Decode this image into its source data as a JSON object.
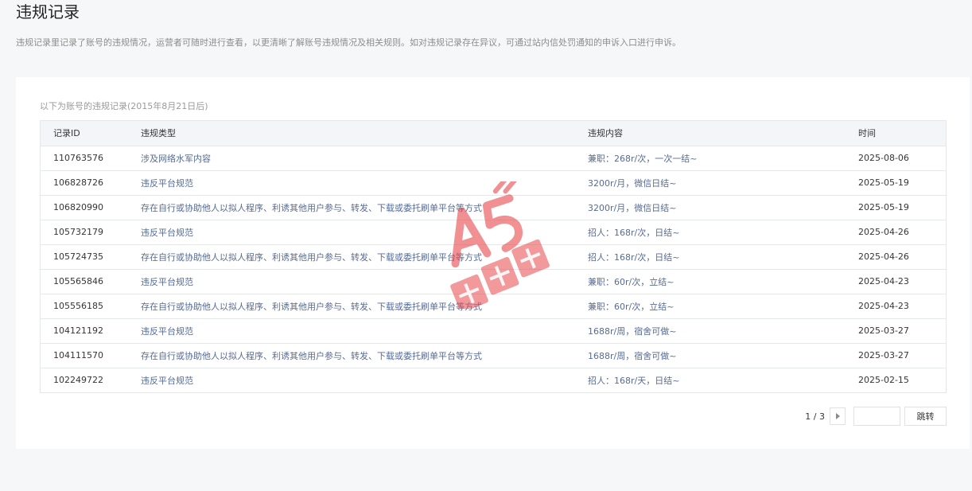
{
  "page": {
    "title": "违规记录",
    "description": "违规记录里记录了账号的违规情况，运营者可随时进行查看，以更清晰了解账号违规情况及相关规则。如对违规记录存在异议，可通过站内信处罚通知的申诉入口进行申诉。"
  },
  "table": {
    "caption": "以下为账号的违规记录(2015年8月21日后)",
    "headers": {
      "id": "记录ID",
      "type": "违规类型",
      "content": "违规内容",
      "time": "时间"
    },
    "rows": [
      {
        "id": "110763576",
        "type": "涉及网络水军内容",
        "content": "兼职：268r/次，一次一结~",
        "time": "2025-08-06"
      },
      {
        "id": "106828726",
        "type": "违反平台规范",
        "content": "3200r/月，微信日结~",
        "time": "2025-05-19"
      },
      {
        "id": "106820990",
        "type": "存在自行或协助他人以拟人程序、利诱其他用户参与、转发、下载或委托刷单平台等方式",
        "content": "3200r/月，微信日结~",
        "time": "2025-05-19"
      },
      {
        "id": "105732179",
        "type": "违反平台规范",
        "content": "招人：168r/次，日结~",
        "time": "2025-04-26"
      },
      {
        "id": "105724735",
        "type": "存在自行或协助他人以拟人程序、利诱其他用户参与、转发、下载或委托刷单平台等方式",
        "content": "招人：168r/次，日结~",
        "time": "2025-04-26"
      },
      {
        "id": "105565846",
        "type": "违反平台规范",
        "content": "兼职：60r/次，立结~",
        "time": "2025-04-23"
      },
      {
        "id": "105556185",
        "type": "存在自行或协助他人以拟人程序、利诱其他用户参与、转发、下载或委托刷单平台等方式",
        "content": "兼职：60r/次，立结~",
        "time": "2025-04-23"
      },
      {
        "id": "104121192",
        "type": "违反平台规范",
        "content": "1688r/周，宿舍可做~",
        "time": "2025-03-27"
      },
      {
        "id": "104111570",
        "type": "存在自行或协助他人以拟人程序、利诱其他用户参与、转发、下载或委托刷单平台等方式",
        "content": "1688r/周，宿舍可做~",
        "time": "2025-03-27"
      },
      {
        "id": "102249722",
        "type": "违反平台规范",
        "content": "招人：168r/天，日结~",
        "time": "2025-02-15"
      }
    ]
  },
  "pagination": {
    "page_indicator": "1 / 3",
    "jump_input_value": "",
    "jump_button_label": "跳转",
    "next_icon": "triangle-right-icon"
  },
  "watermark": {
    "logo_text": "A5",
    "brand_text": "新媒体",
    "color": "#e8474a"
  }
}
